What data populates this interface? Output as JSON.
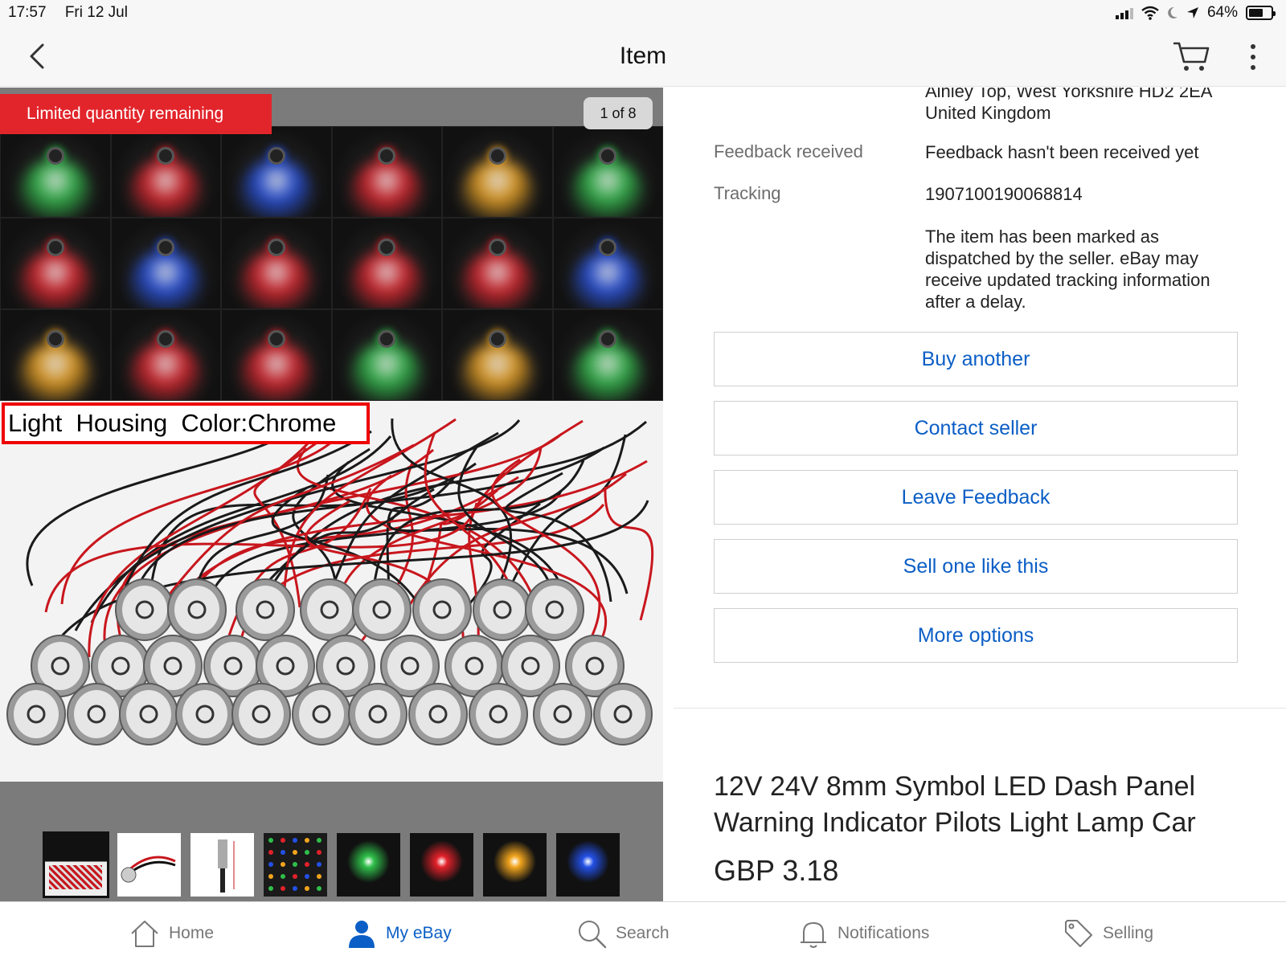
{
  "status_bar": {
    "time": "17:57",
    "date": "Fri 12 Jul",
    "battery": "64%",
    "battery_level": 0.64
  },
  "nav": {
    "title": "Item",
    "icons": [
      "back-chevron-icon",
      "cart-icon",
      "more-vertical-icon"
    ]
  },
  "gallery": {
    "badge_limited": "Limited quantity remaining",
    "counter": "1 of 8",
    "image_label": "Light  Housing  Color:Chrome",
    "led_colors": [
      "#2fbf4a",
      "#e2212a",
      "#2350e6",
      "#e2212a",
      "#f2a51e",
      "#2fbf4a",
      "#e2212a",
      "#2350e6",
      "#e2212a",
      "#e2212a",
      "#e2212a",
      "#2350e6",
      "#f2a51e",
      "#e2212a",
      "#e2212a",
      "#2fbf4a",
      "#f2a51e",
      "#2fbf4a"
    ],
    "thumbnails": [
      {
        "kind": "collage",
        "selected": true
      },
      {
        "kind": "wired-led",
        "selected": false
      },
      {
        "kind": "dimension",
        "selected": false
      },
      {
        "kind": "grid",
        "selected": false
      },
      {
        "kind": "glow",
        "color": "#2fbf4a",
        "selected": false
      },
      {
        "kind": "glow",
        "color": "#e2212a",
        "selected": false
      },
      {
        "kind": "glow",
        "color": "#f2a51e",
        "selected": false
      },
      {
        "kind": "glow",
        "color": "#2350e6",
        "selected": false
      }
    ]
  },
  "details": {
    "address_line_1": "Ainley Top, West Yorkshire HD2 2EA",
    "address_line_2": "United Kingdom",
    "feedback_label": "Feedback received",
    "feedback_value": "Feedback hasn't been received yet",
    "tracking_label": "Tracking",
    "tracking_number": "1907100190068814",
    "tracking_note": "The item has been marked as dispatched by the seller. eBay may receive updated tracking information after a delay."
  },
  "actions": {
    "buy_another": "Buy another",
    "contact_seller": "Contact seller",
    "leave_feedback": "Leave Feedback",
    "sell_one": "Sell one like this",
    "more_options": "More options"
  },
  "product": {
    "title": "12V 24V 8mm Symbol LED Dash Panel Warning Indicator Pilots Light Lamp Car",
    "price": "GBP 3.18"
  },
  "tabbar": {
    "home": "Home",
    "my_ebay": "My eBay",
    "search": "Search",
    "notifications": "Notifications",
    "selling": "Selling",
    "active": "my_ebay"
  },
  "colors": {
    "accent": "#0b5ec6",
    "badge_red": "#e2252b",
    "label_red": "#e00000"
  }
}
